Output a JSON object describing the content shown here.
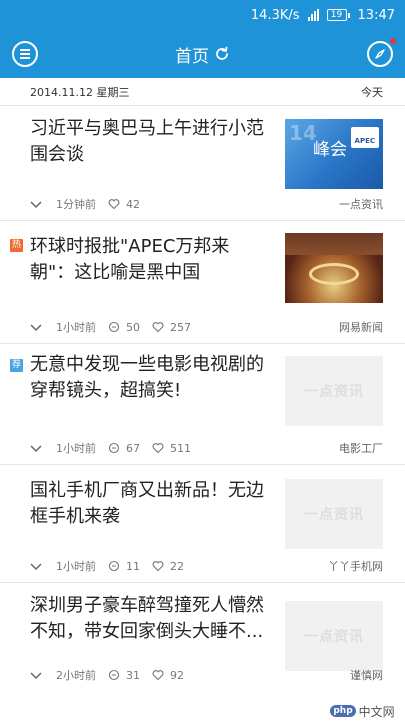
{
  "status_bar": {
    "speed": "14.3K/s",
    "battery": "19",
    "time": "13:47"
  },
  "app_bar": {
    "title": "首页"
  },
  "date_bar": {
    "date": "2014.11.12 星期三",
    "label": "今天"
  },
  "news": [
    {
      "title": "习近平与奥巴马上午进行小范围会谈",
      "tag": "",
      "time": "1分钟前",
      "comments": "",
      "likes": "42",
      "source": "一点资讯",
      "thumb_caption": "峰会",
      "thumb_badge": "APEC",
      "thumb_number": "14",
      "thumb_placeholder": ""
    },
    {
      "title": "环球时报批\"APEC万邦来朝\"：这比喻是黑中国",
      "tag": "热",
      "time": "1小时前",
      "comments": "50",
      "likes": "257",
      "source": "网易新闻",
      "thumb_placeholder": ""
    },
    {
      "title": "无意中发现一些电影电视剧的穿帮镜头，超搞笑!",
      "tag": "荐",
      "time": "1小时前",
      "comments": "67",
      "likes": "511",
      "source": "电影工厂",
      "thumb_placeholder": "一点资讯"
    },
    {
      "title": "国礼手机厂商又出新品！无边框手机来袭",
      "tag": "",
      "time": "1小时前",
      "comments": "11",
      "likes": "22",
      "source": "丫丫手机网",
      "thumb_placeholder": "一点资讯"
    },
    {
      "title": "深圳男子豪车醉驾撞死人懵然不知，带女回家倒头大睡不...",
      "tag": "",
      "time": "2小时前",
      "comments": "31",
      "likes": "92",
      "source": "谨慎网",
      "thumb_placeholder": "一点资讯"
    }
  ],
  "watermark": {
    "badge": "php",
    "text": "中文网"
  }
}
